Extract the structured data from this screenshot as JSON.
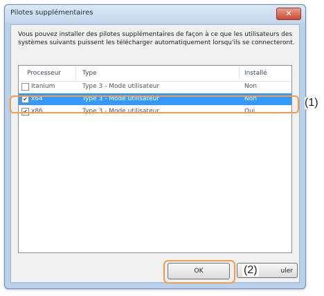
{
  "window": {
    "title": "Pilotes supplémentaires",
    "close_symbol": "✕"
  },
  "description": "Vous pouvez installer des pilotes supplémentaires de façon à ce que les utilisateurs des systèmes suivants puissent les télécharger automatiquement lorsqu'ils se connecteront.",
  "table": {
    "columns": [
      "Processeur",
      "Type",
      "Installé"
    ],
    "rows": [
      {
        "checked": false,
        "processor": "Itanium",
        "type": "Type 3 - Mode utilisateur",
        "installed": "Non"
      },
      {
        "checked": true,
        "processor": "x64",
        "type": "Type 3 - Mode utilisateur",
        "installed": "Non"
      },
      {
        "checked": true,
        "processor": "x86",
        "type": "Type 3 - Mode utilisateur",
        "installed": "Oui"
      }
    ]
  },
  "buttons": {
    "ok": "OK",
    "cancel_partial": "uler"
  },
  "callouts": {
    "one": "(1)",
    "two": "(2)"
  },
  "colors": {
    "selection": "#3399ff",
    "highlight": "#f39c4a"
  }
}
